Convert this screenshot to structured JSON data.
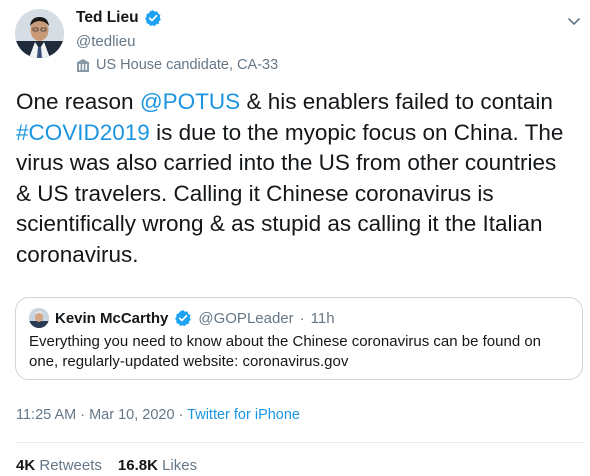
{
  "author": {
    "name": "Ted Lieu",
    "handle": "@tedlieu",
    "label": "US House candidate, CA-33"
  },
  "tweet": {
    "t1": "One reason ",
    "mention": "@POTUS",
    "t2": " & his enablers failed to contain ",
    "hashtag": "#COVID2019",
    "t3": " is due to the myopic focus on China. The virus was also carried into the US from other countries & US travelers. Calling it Chinese coronavirus is scientifically wrong & as stupid as calling it the Italian coronavirus."
  },
  "quote": {
    "name": "Kevin McCarthy",
    "handle": "@GOPLeader",
    "separator": "·",
    "time": "11h",
    "text": "Everything you need to know about the Chinese coronavirus can be found on one, regularly-updated website: coronavirus.gov"
  },
  "meta": {
    "time": "11:25 AM",
    "sep": " · ",
    "date": "Mar 10, 2020",
    "source": "Twitter for iPhone"
  },
  "stats": {
    "retweets_count": "4K",
    "retweets_label": "Retweets",
    "likes_count": "16.8K",
    "likes_label": "Likes"
  },
  "colors": {
    "link": "#1b95e0",
    "verified": "#1da1f2",
    "secondary_text": "#657786"
  },
  "icons": [
    "verified-badge-icon",
    "label-building-icon",
    "chevron-down-icon"
  ]
}
